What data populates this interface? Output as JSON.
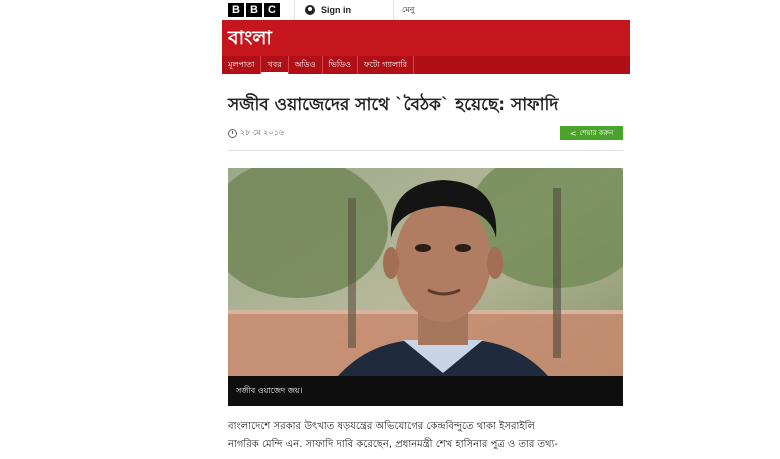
{
  "topbar": {
    "logo_letters": [
      "B",
      "B",
      "C"
    ],
    "signin_label": "Sign in",
    "menu_label": "মেনু"
  },
  "brand": {
    "title": "বাংলা",
    "color": "#c4161c",
    "nav": [
      {
        "label": "মূলপাতা",
        "active": false
      },
      {
        "label": "খবর",
        "active": true
      },
      {
        "label": "অডিও",
        "active": false
      },
      {
        "label": "ভিডিও",
        "active": false
      },
      {
        "label": "ফটো গ্যালারি",
        "active": false
      }
    ]
  },
  "article": {
    "headline": "সজীব ওয়াজেদের সাথে `বৈঠক` হয়েছে: সাফাদি",
    "date": "২৮ মে ২০১৬",
    "share_label": "শেয়ার করুন",
    "photo_caption": "সজীব ওয়াজেদ জয়।",
    "body_lines": [
      "বাংলাদেশে সরকার উৎখাত ষড়যন্ত্রের অভিযোগের কেন্দ্রবিন্দুতে থাকা ইসরাইলি",
      "নাগরিক মেন্দি এন. সাফাদি দাবি করেছেন, প্রধানমন্ত্রী শেখ হাসিনার পুত্র ও তার তথ্য-"
    ]
  }
}
